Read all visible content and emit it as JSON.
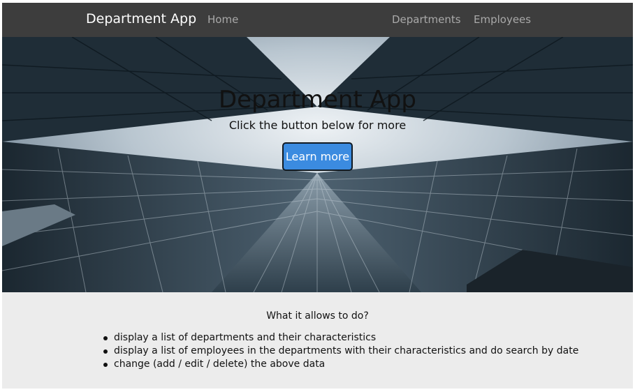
{
  "navbar": {
    "brand": "Department App",
    "links": [
      {
        "label": "Home"
      },
      {
        "label": "Departments"
      },
      {
        "label": "Employees"
      }
    ],
    "background": "#3d3d3d"
  },
  "hero": {
    "title": "Department App",
    "subtitle": "Click the button below for more",
    "button_label": "Learn more",
    "button_color": "#3b8be0"
  },
  "info": {
    "heading": "What it allows to do?",
    "items": [
      "display a list of departments and their characteristics",
      "display a list of employees in the departments with their characteristics and do search by date",
      "change (add / edit / delete) the above data"
    ],
    "background": "#ececec"
  }
}
